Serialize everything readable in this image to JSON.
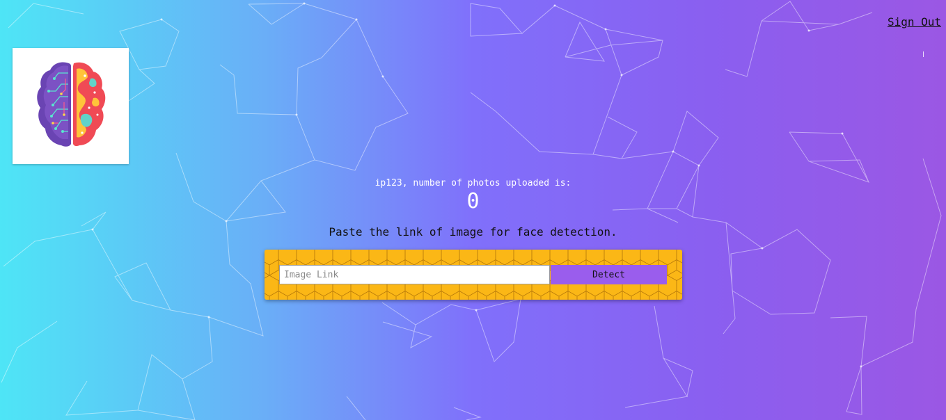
{
  "nav": {
    "sign_out_label": "Sign Out"
  },
  "logo": {
    "icon": "brain-icon"
  },
  "rank": {
    "message": "ip123, number of photos uploaded is:",
    "count": "0"
  },
  "detect": {
    "prompt": "Paste the link of image for face detection.",
    "input_placeholder": "Image Link",
    "input_value": "",
    "button_label": "Detect"
  },
  "colors": {
    "gradient_start": "#4ee5f6",
    "gradient_mid": "#8070fb",
    "gradient_end": "#9b57e4",
    "form_background": "#fbb716",
    "button": "#9a5ded"
  }
}
